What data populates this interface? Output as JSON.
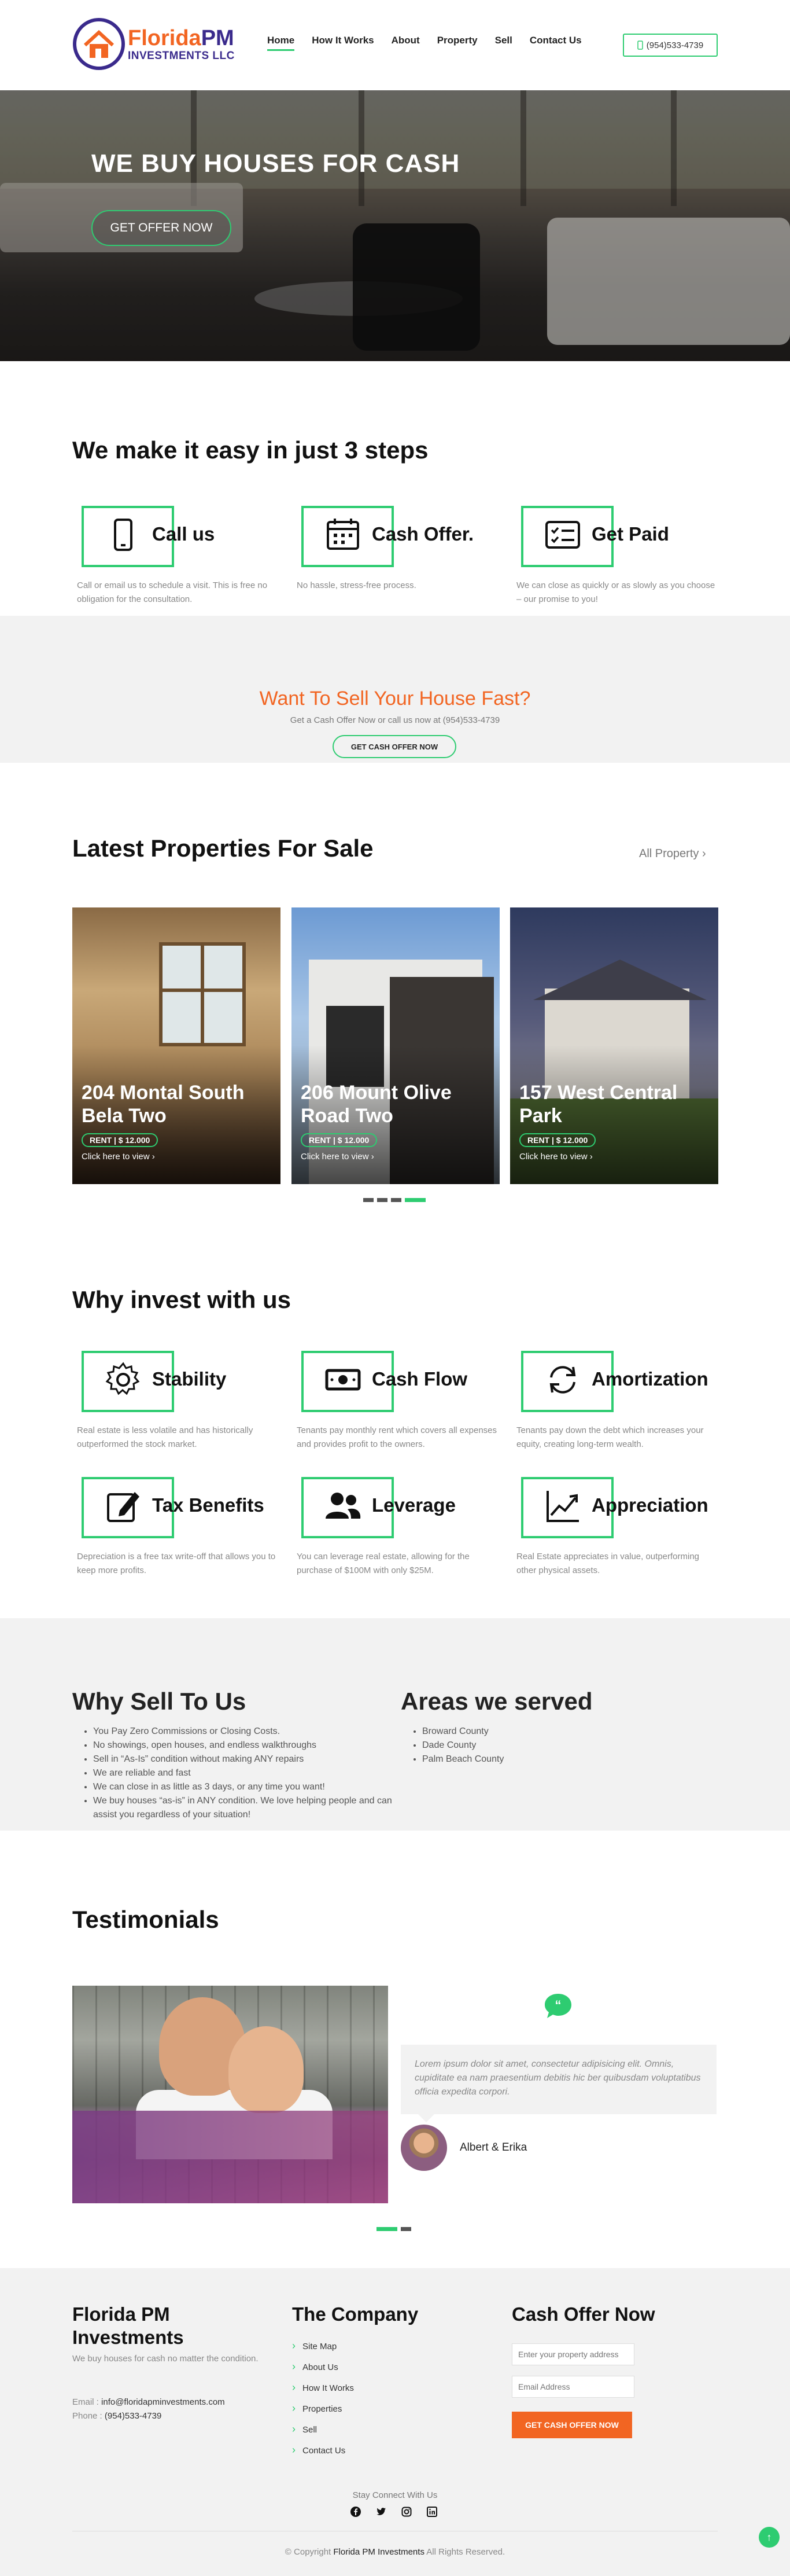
{
  "brand": {
    "name_part1": "Florida",
    "name_part2": "PM",
    "name_line2": "INVESTMENTS LLC"
  },
  "nav": [
    {
      "label": "Home"
    },
    {
      "label": "How It Works"
    },
    {
      "label": "About"
    },
    {
      "label": "Property"
    },
    {
      "label": "Sell"
    },
    {
      "label": "Contact Us"
    }
  ],
  "header": {
    "phone": "(954)533-4739"
  },
  "hero": {
    "title": "WE BUY HOUSES FOR CASH",
    "button": "GET OFFER NOW"
  },
  "steps": {
    "title": "We make it easy in just 3 steps",
    "items": [
      {
        "icon": "phone-icon",
        "title": "Call us",
        "desc": "Call or email us to schedule a visit. This is free no obligation for the consultation."
      },
      {
        "icon": "calendar-icon",
        "title": "Cash Offer.",
        "desc": "No hassle, stress-free process."
      },
      {
        "icon": "checklist-icon",
        "title": "Get Paid",
        "desc": "We can close as quickly or as slowly as you choose – our promise to you!"
      }
    ]
  },
  "cta": {
    "title": "Want To Sell Your House Fast?",
    "text": "Get a Cash Offer Now or call us now at (954)533-4739",
    "button": "GET CASH OFFER NOW"
  },
  "properties": {
    "title": "Latest Properties For Sale",
    "all_link": "All Property",
    "items": [
      {
        "title": "204 Montal South Bela Two",
        "rent": "RENT | $ 12.000",
        "link": "Click here to view"
      },
      {
        "title": "206 Mount Olive Road Two",
        "rent": "RENT | $ 12.000",
        "link": "Click here to view"
      },
      {
        "title": "157 West Central Park",
        "rent": "RENT | $ 12.000",
        "link": "Click here to view"
      }
    ],
    "active_slide": 4
  },
  "invest": {
    "title": "Why invest with us",
    "items": [
      {
        "icon": "gear-icon",
        "title": "Stability",
        "desc": "Real estate is less volatile and has historically outperformed the stock market."
      },
      {
        "icon": "cash-icon",
        "title": "Cash Flow",
        "desc": "Tenants pay monthly rent which covers all expenses and provides profit to the owners."
      },
      {
        "icon": "refresh-icon",
        "title": "Amortization",
        "desc": "Tenants pay down the debt which increases your equity, creating long-term wealth."
      },
      {
        "icon": "edit-icon",
        "title": "Tax Benefits",
        "desc": "Depreciation is a free tax write-off that allows you to keep more profits."
      },
      {
        "icon": "users-icon",
        "title": "Leverage",
        "desc": "You can leverage real estate, allowing for the purchase of $100M with only $25M."
      },
      {
        "icon": "chart-line-icon",
        "title": "Appreciation",
        "desc": "Real Estate appreciates in value, outperforming other physical assets."
      }
    ]
  },
  "why_sell": {
    "title": "Why Sell To Us",
    "items": [
      "You Pay Zero Commissions or Closing Costs.",
      "No showings, open houses, and endless walkthroughs",
      "Sell in “As-Is” condition without making ANY repairs",
      "We are reliable and fast",
      "We can close in as little as 3 days, or any time you want!",
      "We buy houses “as-is” in ANY condition. We love helping people and can assist you regardless of your situation!"
    ]
  },
  "areas": {
    "title": "Areas we served",
    "items": [
      "Broward County",
      "Dade County",
      "Palm Beach County"
    ]
  },
  "testimonials": {
    "title": "Testimonials",
    "quote": "Lorem ipsum dolor sit amet, consectetur adipisicing elit. Omnis, cupiditate ea nam praesentium debitis hic ber quibusdam voluptatibus officia expedita corpori.",
    "author": "Albert & Erika"
  },
  "footer": {
    "col1_title": "Florida PM Investments",
    "about": "We buy houses for cash no matter the condition.",
    "email_label": "Email : ",
    "email": "info@floridapminvestments.com",
    "phone_label": "Phone : ",
    "phone": "(954)533-4739",
    "col2_title": "The Company",
    "links": [
      "Site Map",
      "About Us",
      "How It Works",
      "Properties",
      "Sell",
      "Contact Us"
    ],
    "col3_title": "Cash Offer Now",
    "address_placeholder": "Enter your property address",
    "email_placeholder": "Email Address",
    "submit": "GET CASH OFFER NOW",
    "stay": "Stay Connect With Us",
    "copy_prefix": "© Copyright ",
    "copy_brand": "Florida PM Investments",
    "copy_suffix": " All Rights Reserved."
  },
  "colors": {
    "accent": "#2ecc71",
    "orange": "#f26522",
    "purple": "#3a2a8c",
    "band": "#f2f2f2"
  }
}
